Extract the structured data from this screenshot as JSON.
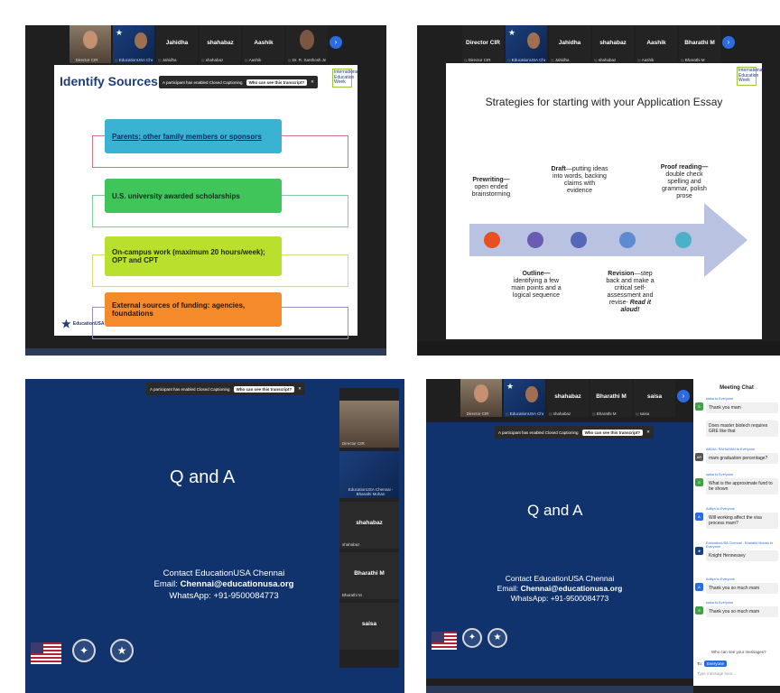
{
  "panel1": {
    "tiles": [
      {
        "name": "",
        "label": "Director CIR"
      },
      {
        "name": "",
        "label": "EducationUSA Chennai - S..."
      },
      {
        "name": "Jahidha",
        "label": "Jahidha"
      },
      {
        "name": "shahabaz",
        "label": "shahabaz"
      },
      {
        "name": "Aashik",
        "label": "Aashik"
      },
      {
        "name": "",
        "label": "Dr. R. Santhosh Jeeven"
      }
    ],
    "caption_banner": {
      "text": "A participant has enabled Closed Captioning",
      "button": "Who can see this transcript?"
    },
    "slide": {
      "title": "Identify Sources of Funding",
      "ie_week": "International Education Week",
      "items": [
        "Parents; other family members or sponsors",
        "U.S. university awarded scholarships",
        "On-campus work (maximum 20 hours/week); OPT and CPT",
        "External sources of funding: agencies, foundations"
      ],
      "logo": "EducationUSA"
    }
  },
  "panel2": {
    "tiles": [
      {
        "name": "Director CIR",
        "label": "Director CIR"
      },
      {
        "name": "",
        "label": "EducationUSA Chennai - S..."
      },
      {
        "name": "Jahidha",
        "label": "Jahidha"
      },
      {
        "name": "shahabaz",
        "label": "shahabaz"
      },
      {
        "name": "Aashik",
        "label": "Aashik"
      },
      {
        "name": "Bharathi M",
        "label": "Bharathi M"
      }
    ],
    "slide": {
      "title": "Strategies for starting with  your Application Essay",
      "ie_week": "International Education Week",
      "steps_top": [
        {
          "head": "Prewriting—",
          "body": "open ended brainstorming"
        },
        {
          "head": "Draft",
          "body": "—putting ideas into words, backing claims with evidence"
        },
        {
          "head": "Proof reading—",
          "body": "double check spelling and grammar, polish prose"
        }
      ],
      "steps_bottom": [
        {
          "head": "Outline—",
          "body": "identifying a few main points and a logical sequence"
        },
        {
          "head": "Revision",
          "body": "—step back and make a critical self-assessment and revise- ",
          "emph": "Read it aloud!"
        }
      ],
      "dot_colors": [
        "#e8501f",
        "#6b5bb3",
        "#5567b8",
        "#5e8ad0",
        "#4bb1c8"
      ]
    }
  },
  "panel3": {
    "caption_banner": {
      "text": "A participant has enabled Closed Captioning",
      "button": "Who can see this transcript?"
    },
    "title": "Q and A",
    "contact_line1": "Contact EducationUSA Chennai",
    "contact_email_label": "Email: ",
    "contact_email": "Chennai@educationusa.org",
    "contact_whatsapp": "WhatsApp: +91-9500084773",
    "side_tiles": [
      {
        "name": "",
        "label": "Director CIR"
      },
      {
        "name": "",
        "label": "EducationUSA Chennai - Bharathi Mohan"
      },
      {
        "name": "shahabaz",
        "label": "shahabaz"
      },
      {
        "name": "Bharathi M",
        "label": "Bharathi M"
      },
      {
        "name": "saisa",
        "label": ""
      }
    ]
  },
  "panel4": {
    "tiles": [
      {
        "name": "",
        "label": "Director CIR"
      },
      {
        "name": "",
        "label": "EducationUSA Chennai - S..."
      },
      {
        "name": "shahabaz",
        "label": "shahabaz"
      },
      {
        "name": "Bharathi M",
        "label": "Bharathi M"
      },
      {
        "name": "saisa",
        "label": "saisa"
      }
    ],
    "caption_banner": {
      "text": "A participant has enabled Closed Captioning",
      "button": "Who can see this transcript?"
    },
    "title": "Q and A",
    "contact_line1": "Contact EducationUSA Chennai",
    "contact_email_label": "Email: ",
    "contact_email": "Chennai@educationusa.org",
    "contact_whatsapp": "WhatsApp: +91-9500084773",
    "chat": {
      "header": "Meeting Chat",
      "messages": [
        {
          "from": "saisa to Everyone",
          "text": "Thank you mam"
        },
        {
          "from": "",
          "text": "Does master biotech requires GRE like that"
        },
        {
          "from": "ABDUL RAHUMAN to Everyone",
          "text": "mam graduation percentage?"
        },
        {
          "from": "saisa to Everyone",
          "text": "What is the approximate fund to be shown"
        },
        {
          "from": "Aditya to Everyone",
          "text": "Will working affect the visa process mam?"
        },
        {
          "from": "EducationUSA Chennai - Bharathi Mohan to Everyone",
          "text": "Knight Hennessey"
        },
        {
          "from": "Aditya to Everyone",
          "text": "Thank you so much mam"
        },
        {
          "from": "saisa to Everyone",
          "text": "Thank you so much mam"
        }
      ],
      "who_can_see": "Who can see your messages?",
      "to_label": "To:",
      "to_value": "Everyone",
      "placeholder": "Type message here..."
    }
  }
}
